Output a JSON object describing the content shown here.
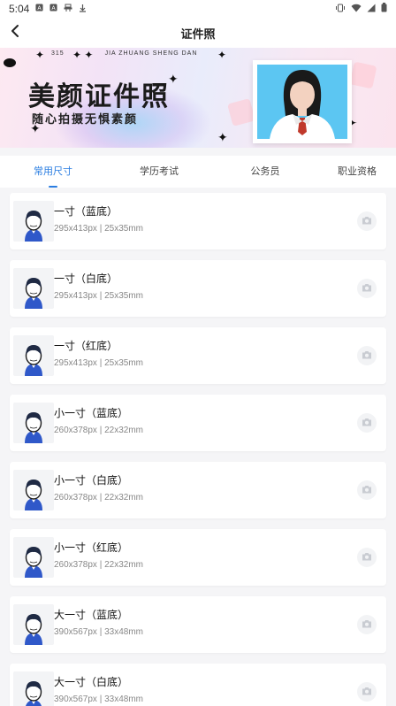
{
  "status_bar": {
    "time": "5:04",
    "left_icons": [
      "a-box-icon",
      "a-box-icon",
      "notification-icon",
      "download-icon"
    ],
    "right_icons": [
      "vibrate-icon",
      "wifi-icon",
      "signal-icon",
      "battery-icon"
    ]
  },
  "nav": {
    "title": "证件照",
    "back_icon": "chevron-left-icon"
  },
  "banner": {
    "top_text_left": "315",
    "top_text_mid": "JIA ZHUANG SHENG DAN",
    "title": "美颜证件照",
    "subtitle": "随心拍摄无惧素颜",
    "photo_bg_color": "#5cc6f2"
  },
  "tabs": [
    {
      "label": "常用尺寸",
      "active": true
    },
    {
      "label": "学历考试",
      "active": false
    },
    {
      "label": "公务员",
      "active": false
    },
    {
      "label": "职业资格",
      "active": false
    }
  ],
  "accent_color": "#2a7de1",
  "items": [
    {
      "title": "一寸（蓝底）",
      "spec": "295x413px | 25x35mm"
    },
    {
      "title": "一寸（白底）",
      "spec": "295x413px | 25x35mm"
    },
    {
      "title": "一寸（红底）",
      "spec": "295x413px | 25x35mm"
    },
    {
      "title": "小一寸（蓝底）",
      "spec": "260x378px | 22x32mm"
    },
    {
      "title": "小一寸（白底）",
      "spec": "260x378px | 22x32mm"
    },
    {
      "title": "小一寸（红底）",
      "spec": "260x378px | 22x32mm"
    },
    {
      "title": "大一寸（蓝底）",
      "spec": "390x567px | 33x48mm"
    },
    {
      "title": "大一寸（白底）",
      "spec": "390x567px | 33x48mm"
    }
  ]
}
